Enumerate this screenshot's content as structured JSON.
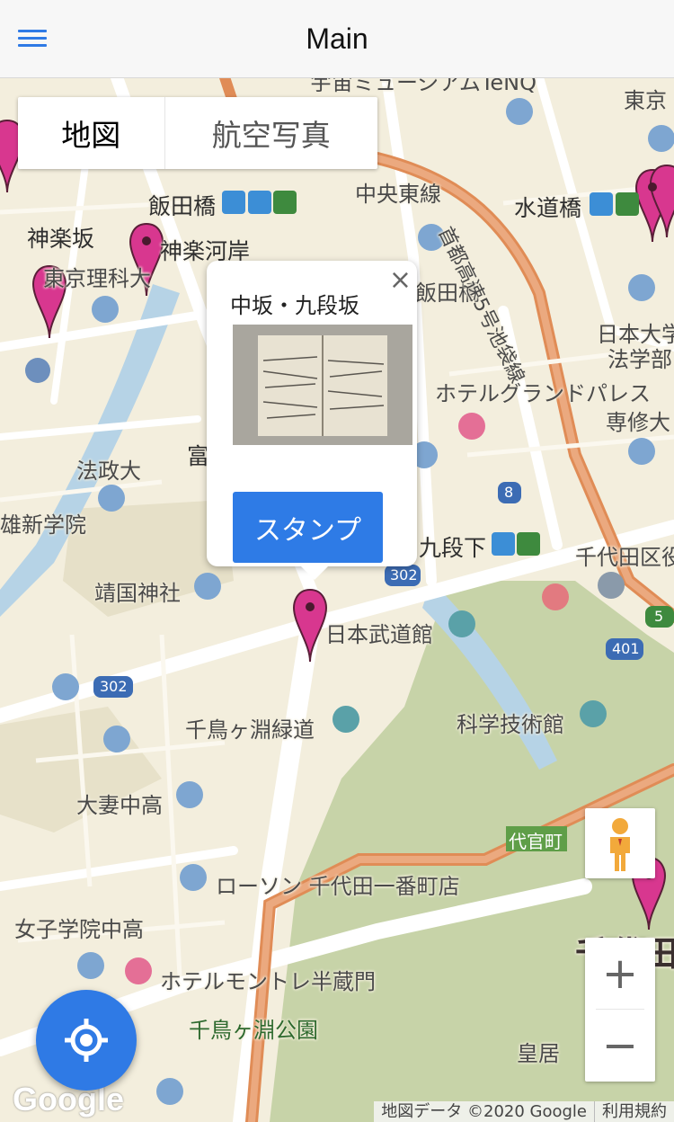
{
  "app_bar": {
    "title": "Main",
    "menu_icon": "hamburger-menu-icon"
  },
  "map_type": {
    "map_label": "地図",
    "satellite_label": "航空写真"
  },
  "popup": {
    "title": "中坂・九段坂",
    "button_label": "スタンプ",
    "close_symbol": "×",
    "image_desc": "woodblock-print-book-image"
  },
  "labels": [
    "飯田橋",
    "中央東線",
    "首都高速5号池袋線",
    "水道橋",
    "神楽坂",
    "神楽河岸",
    "東京理科大",
    "飯田橋",
    "日本大学",
    "法学部",
    "ホテルグランドパレス",
    "専修大",
    "法政大",
    "富",
    "雄新学院",
    "九段下",
    "千代田区役",
    "靖国神社",
    "日本武道館",
    "千鳥ヶ淵緑道",
    "科学技術館",
    "大妻中高",
    "代官町",
    "ローソン 千代田一番町店",
    "女子学院中高",
    "ホテルモントレ半蔵門",
    "千鳥ヶ淵公園",
    "皇居",
    "千代田",
    "東京",
    "宇宙ミュージアムTeNQ"
  ],
  "route_shields": [
    "302",
    "302",
    "8",
    "401",
    "5"
  ],
  "controls": {
    "zoom_in": "+",
    "zoom_out": "−"
  },
  "attribution": {
    "data": "地図データ ©2020 Google",
    "terms": "利用規約",
    "logo": "Google"
  },
  "colors": {
    "accent": "#2f7ae5",
    "marker": "#d8378f",
    "park": "#c9d6ab",
    "expressway": "#e5986a"
  }
}
